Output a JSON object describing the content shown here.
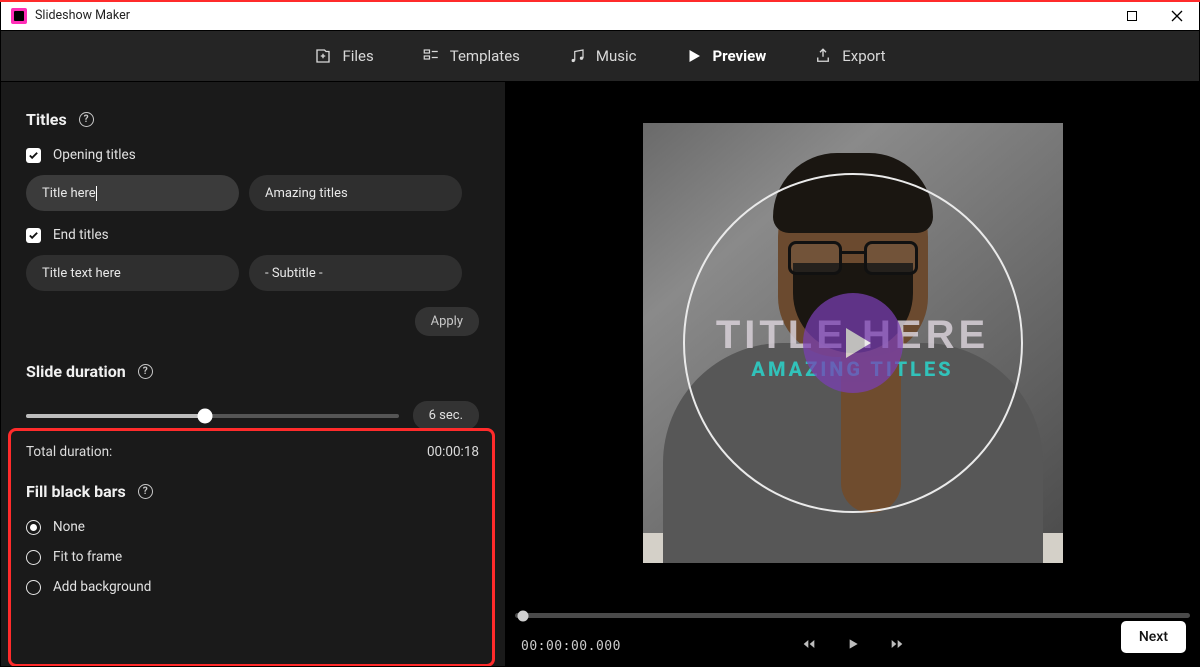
{
  "app": {
    "title": "Slideshow Maker"
  },
  "nav": {
    "files": "Files",
    "templates": "Templates",
    "music": "Music",
    "preview": "Preview",
    "export": "Export"
  },
  "titles": {
    "heading": "Titles",
    "opening_label": "Opening titles",
    "end_label": "End titles",
    "input_title": "Title here",
    "input_subtitle": "Amazing titles",
    "end_input_title": "Title text here",
    "end_input_subtitle": "- Subtitle -",
    "apply": "Apply"
  },
  "slide": {
    "heading": "Slide duration",
    "value_label": "6 sec.",
    "total_label": "Total duration:",
    "total_value": "00:00:18"
  },
  "fill": {
    "heading": "Fill black bars",
    "none": "None",
    "fit": "Fit to frame",
    "addbg": "Add background"
  },
  "preview": {
    "overlay_title": "TITLE HERE",
    "overlay_subtitle": "AMAZING TITLES",
    "timecode": "00:00:00.000"
  },
  "footer": {
    "next": "Next"
  }
}
